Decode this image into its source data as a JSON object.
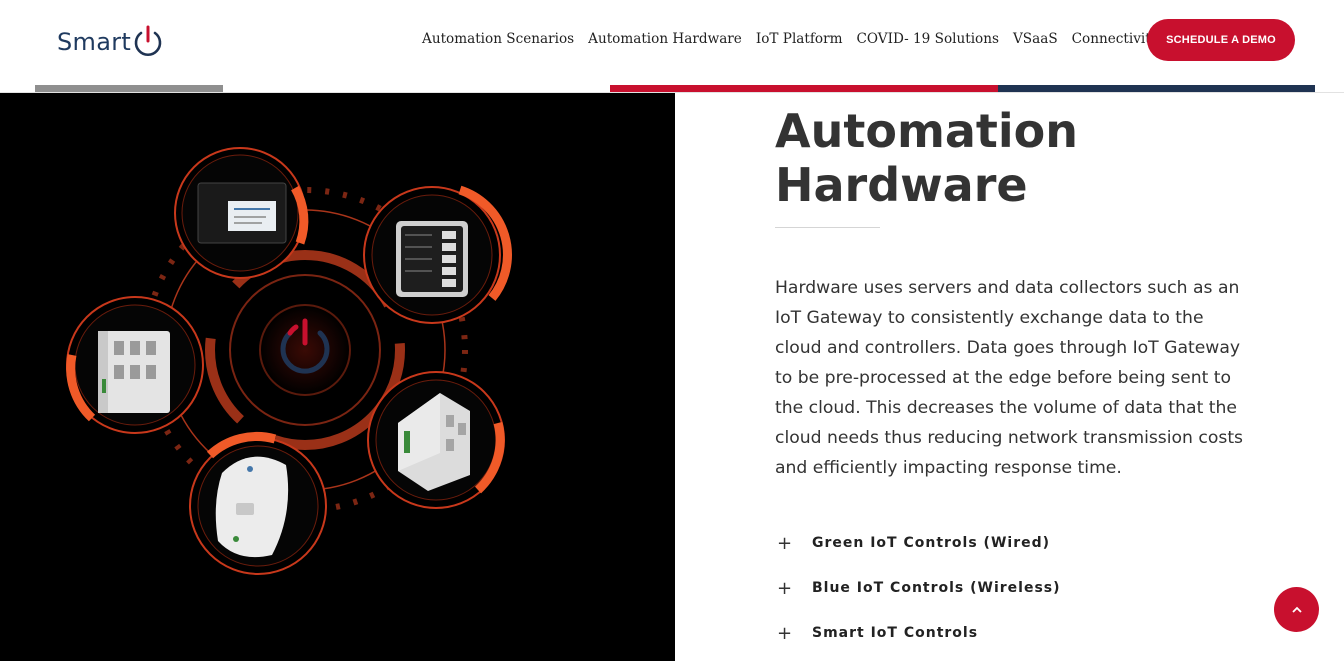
{
  "header": {
    "logo_text": "Smart",
    "logo_icon": "power-icon",
    "nav": [
      {
        "label": "Automation Scenarios"
      },
      {
        "label": "Automation Hardware"
      },
      {
        "label": "IoT Platform"
      },
      {
        "label": "COVID- 19 Solutions"
      },
      {
        "label": "VSaaS"
      },
      {
        "label": "Connectivity"
      }
    ],
    "cta_label": "SCHEDULE A DEMO"
  },
  "colors": {
    "brand_red": "#c8102e",
    "brand_navy": "#1f3352",
    "accent_orange": "#f05a28",
    "panel_bg": "#000000"
  },
  "hero_image": {
    "description_icon": "iot-hardware-illustration"
  },
  "main": {
    "title": "Automation Hardware",
    "description": "Hardware uses servers and data collectors such as an IoT Gateway to consistently exchange data to the cloud and controllers. Data goes through IoT Gateway to be pre-processed at the edge before being sent to the cloud. This decreases the volume of data that the cloud needs thus reducing network transmission costs and efficiently impacting response time.",
    "accordion": [
      {
        "icon": "plus-icon",
        "label": "Green IoT Controls (Wired)"
      },
      {
        "icon": "plus-icon",
        "label": "Blue IoT Controls (Wireless)"
      },
      {
        "icon": "plus-icon",
        "label": "Smart IoT Controls"
      }
    ]
  },
  "scroll_top": {
    "icon": "chevron-up-icon"
  }
}
